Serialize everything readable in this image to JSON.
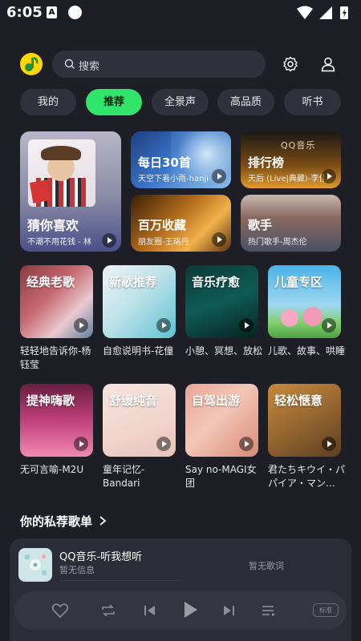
{
  "status_bar": {
    "time": "6:05",
    "notif_letter": "A"
  },
  "header": {
    "search_placeholder": "搜索"
  },
  "tabs": [
    {
      "label": "我的",
      "active": false
    },
    {
      "label": "推荐",
      "active": true
    },
    {
      "label": "全景声",
      "active": false
    },
    {
      "label": "高品质",
      "active": false
    },
    {
      "label": "听书",
      "active": false
    }
  ],
  "featured": {
    "guess": {
      "title": "猜你喜欢",
      "subtitle": "不潮不用花钱 - 林"
    },
    "daily": {
      "title": "每日30首",
      "subtitle": "天空下着小雨-hanji"
    },
    "charts": {
      "title": "排行榜",
      "subtitle": "天后 (Live|典藏)-李佳",
      "brand": "QQ音乐"
    },
    "million": {
      "title": "百万收藏",
      "subtitle": "朋友圈-王珞丹"
    },
    "singer": {
      "title": "歌手",
      "subtitle": "热门歌手-周杰伦"
    }
  },
  "tiles_row1": [
    {
      "title": "经典老歌",
      "caption": "轻轻地告诉你-杨钰莹"
    },
    {
      "title": "新歌推荐",
      "caption": "自愈说明书-花僮"
    },
    {
      "title": "音乐疗愈",
      "caption": "小憩、冥想、放松"
    },
    {
      "title": "儿童专区",
      "caption": "儿歌、故事、哄睡"
    }
  ],
  "tiles_row2": [
    {
      "title": "提神嗨歌",
      "caption": "无可言喻-M2U"
    },
    {
      "title": "舒缓纯音",
      "caption": "童年记忆-Bandari"
    },
    {
      "title": "自驾出游",
      "caption": "Say no-MAGI女团"
    },
    {
      "title": "轻松惬意",
      "caption": "君たちキウイ・パパイア・マン…"
    }
  ],
  "section": {
    "title": "你的私荐歌单"
  },
  "player": {
    "title": "QQ音乐-听我想听",
    "subtitle": "暂无信息",
    "lyric": "暂无歌词",
    "quality": "标准"
  },
  "colors": {
    "accent": "#31e56b",
    "background": "#1e1f26",
    "logo": "#ffd600"
  }
}
